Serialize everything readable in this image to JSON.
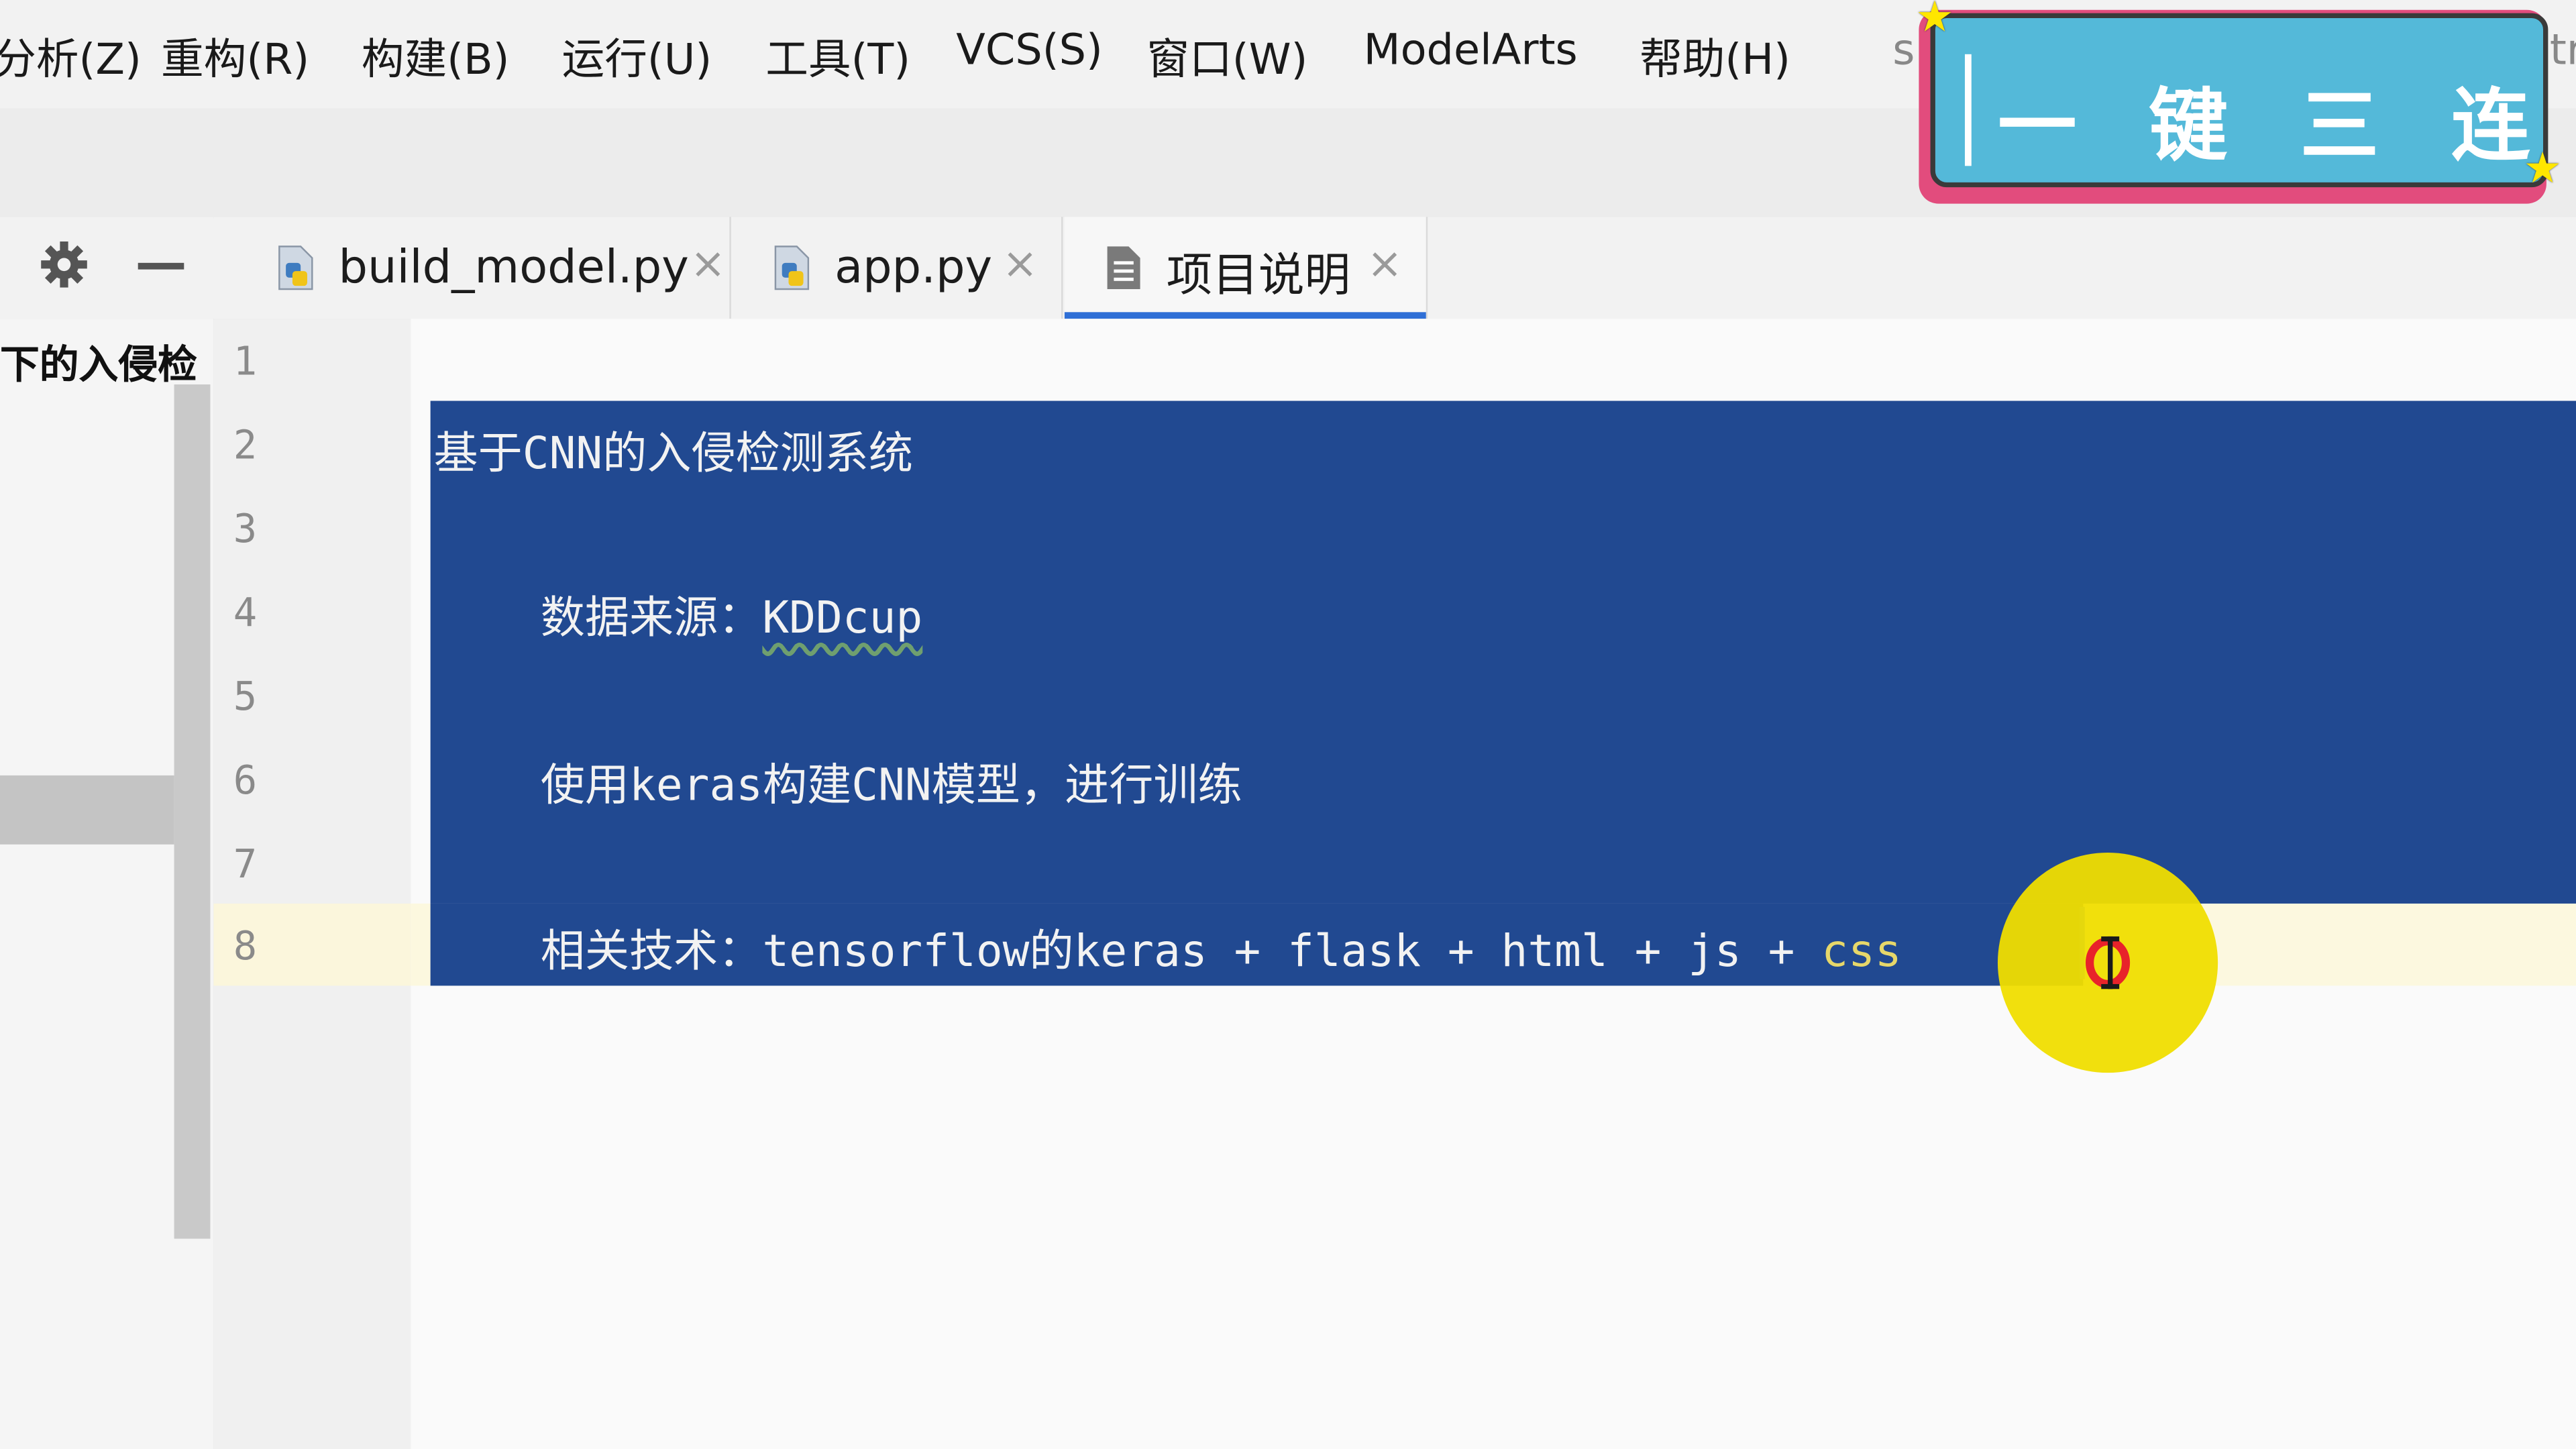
{
  "menu": {
    "items": [
      "分析(Z)",
      "重构(R)",
      "构建(B)",
      "运行(U)",
      "工具(T)",
      "VCS(S)",
      "窗口(W)",
      "ModelArts",
      "帮助(H)"
    ],
    "clipped_right": "s",
    "clipped_far_right": "tr"
  },
  "project_panel": {
    "label": "下的入侵检"
  },
  "toolbar": {
    "settings_icon": "gear-icon",
    "collapse_icon": "minus-icon"
  },
  "tabs": [
    {
      "label": "build_model.py",
      "icon": "python-file-icon",
      "active": false
    },
    {
      "label": "app.py",
      "icon": "python-file-icon",
      "active": false
    },
    {
      "label": "项目说明",
      "icon": "text-file-icon",
      "active": true
    }
  ],
  "tab_close_glyph": "×",
  "editor": {
    "line_numbers": [
      "1",
      "2",
      "3",
      "4",
      "5",
      "6",
      "7",
      "8"
    ],
    "current_line": "8",
    "lines": {
      "l2": "基于CNN的入侵检测系统",
      "l4_prefix": "    数据来源：",
      "l4_word": "KDDcup",
      "l6": "    使用keras构建CNN模型，进行训练",
      "l8_prefix": "    相关技术：tensorflow的keras + flask + html + js + ",
      "l8_css": "css"
    }
  },
  "overlay": {
    "badge_text": "一键三连",
    "star_glyph": "★"
  },
  "colors": {
    "selection": "#214991",
    "current_line": "#fcf8df",
    "cursor_highlight": "#f0de00",
    "badge_fill": "#54b9d9",
    "badge_border": "#e24c7d",
    "active_tab_underline": "#2f6fd6"
  }
}
